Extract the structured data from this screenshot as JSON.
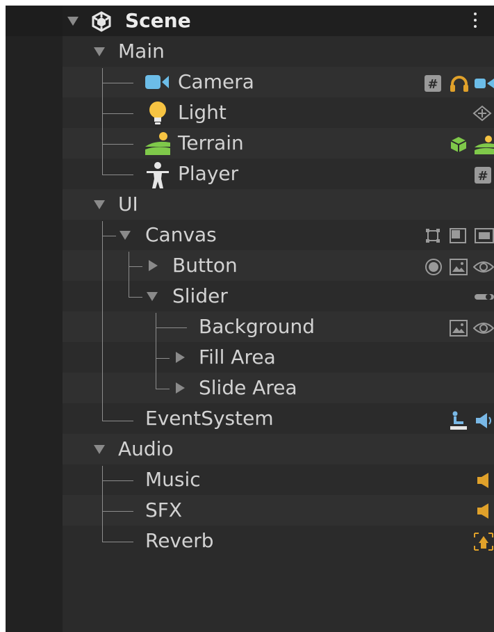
{
  "header": {
    "title": "Scene",
    "menu_icon": "kebab-menu-icon"
  },
  "groups": {
    "main": {
      "label": "Main"
    },
    "ui": {
      "label": "UI"
    },
    "audio": {
      "label": "Audio"
    }
  },
  "objects": {
    "camera": {
      "label": "Camera",
      "icons": [
        "script-icon",
        "headphones-icon",
        "camera-icon"
      ]
    },
    "light": {
      "label": "Light",
      "icons": [
        "light-direction-icon"
      ]
    },
    "terrain": {
      "label": "Terrain",
      "icons": [
        "cube-icon",
        "terrain-icon"
      ]
    },
    "player": {
      "label": "Player",
      "icons": [
        "script-icon"
      ]
    },
    "canvas": {
      "label": "Canvas",
      "icons": [
        "rect-transform-icon",
        "canvas-scaler-icon",
        "graphic-raycaster-icon"
      ]
    },
    "button": {
      "label": "Button",
      "icons": [
        "button-icon",
        "image-icon",
        "eye-icon"
      ]
    },
    "slider": {
      "label": "Slider",
      "icons": [
        "slider-icon"
      ]
    },
    "background": {
      "label": "Background",
      "icons": [
        "image-icon",
        "eye-icon"
      ]
    },
    "fill_area": {
      "label": "Fill Area"
    },
    "slide_area": {
      "label": "Slide Area"
    },
    "event_system": {
      "label": "EventSystem",
      "icons": [
        "event-system-icon",
        "input-module-icon"
      ]
    },
    "music": {
      "label": "Music",
      "icons": [
        "audio-source-icon"
      ]
    },
    "sfx": {
      "label": "SFX",
      "icons": [
        "audio-source-icon"
      ]
    },
    "reverb": {
      "label": "Reverb",
      "icons": [
        "reverb-zone-icon"
      ]
    }
  },
  "colors": {
    "panel_bg": "#2b2b2b",
    "row_alt": "#303030",
    "text": "#d2d2d2",
    "camera_blue": "#6cbde8",
    "light_yellow": "#f6c342",
    "terrain_green": "#7fc94a",
    "audio_orange": "#e0a12a",
    "eventsystem_blue": "#79b8e6"
  }
}
